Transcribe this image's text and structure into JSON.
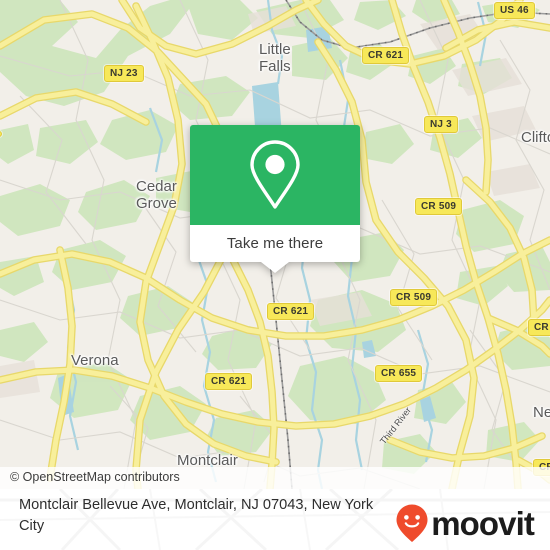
{
  "callout": {
    "button_label": "Take me there",
    "pin_icon": "map-pin-icon",
    "accent_color": "#2bb563"
  },
  "map": {
    "attribution": "© OpenStreetMap contributors",
    "background_color": "#f2efe9",
    "park_color": "#cfe6bd",
    "water_color": "#a8d3e0",
    "road_color": "#f8ef9b",
    "shields": [
      {
        "label": "NJ 23"
      },
      {
        "label": "US 46"
      },
      {
        "label": "CR 621"
      },
      {
        "label": "NJ 3"
      },
      {
        "label": "CR 509"
      },
      {
        "label": "CR 509"
      },
      {
        "label": "CR 621"
      },
      {
        "label": "CR 621"
      },
      {
        "label": "CR 655"
      },
      {
        "label": "CR"
      },
      {
        "label": "CR"
      },
      {
        "label": ""
      }
    ],
    "places": [
      {
        "label": "Little\nFalls"
      },
      {
        "label": "Cedar\nGrove"
      },
      {
        "label": "Clifton"
      },
      {
        "label": "Verona"
      },
      {
        "label": "Montclair"
      },
      {
        "label": "Ne"
      }
    ],
    "rivers": [
      {
        "label": "Third River"
      }
    ]
  },
  "footer": {
    "title": "Montclair Bellevue Ave, Montclair, NJ 07043, New York City",
    "brand": "moovit",
    "brand_color": "#ef4b2c"
  }
}
